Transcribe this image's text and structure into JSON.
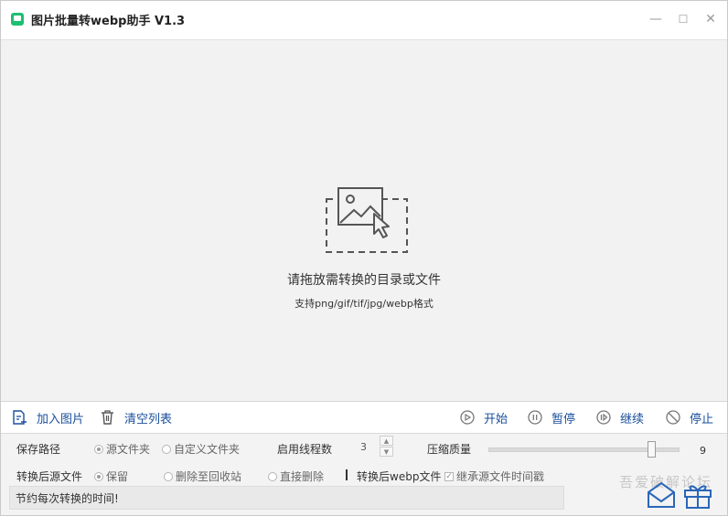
{
  "app": {
    "title": "图片批量转webp助手 V1.3"
  },
  "window_controls": {
    "minimize": "—",
    "maximize": "☐",
    "close": "✕"
  },
  "drop_zone": {
    "prompt": "请拖放需转换的目录或文件",
    "formats": "支持png/gif/tif/jpg/webp格式"
  },
  "toolbar": {
    "add_images": "加入图片",
    "clear_list": "清空列表",
    "start": "开始",
    "pause": "暂停",
    "resume": "继续",
    "stop": "停止"
  },
  "settings": {
    "save_path_label": "保存路径",
    "save_path_options": [
      "源文件夹",
      "自定义文件夹"
    ],
    "save_path_selected": "源文件夹",
    "threads_label": "启用线程数",
    "threads_value": "3",
    "quality_label": "压缩质量",
    "quality_value": "9",
    "quality_level": 0.86,
    "source_after_label": "转换后源文件",
    "source_after_options": [
      "保留",
      "删除至回收站",
      "直接删除"
    ],
    "source_after_selected": "保留",
    "webp_after_label": "转换后webp文件",
    "inherit_timestamp": "继承源文件时间戳",
    "inherit_timestamp_checked": true
  },
  "status": {
    "message": "节约每次转换的时间!"
  },
  "watermark": {
    "text": "吾爱破解论坛"
  },
  "colors": {
    "accent": "#1a4f9c",
    "brand": "#1dbf73",
    "drop_bg": "#f2f2f2"
  },
  "icons": {
    "add": "add-image-icon",
    "clear": "trash-icon",
    "start": "play-icon",
    "pause": "pause-icon",
    "resume": "resume-icon",
    "stop": "stop-icon"
  }
}
